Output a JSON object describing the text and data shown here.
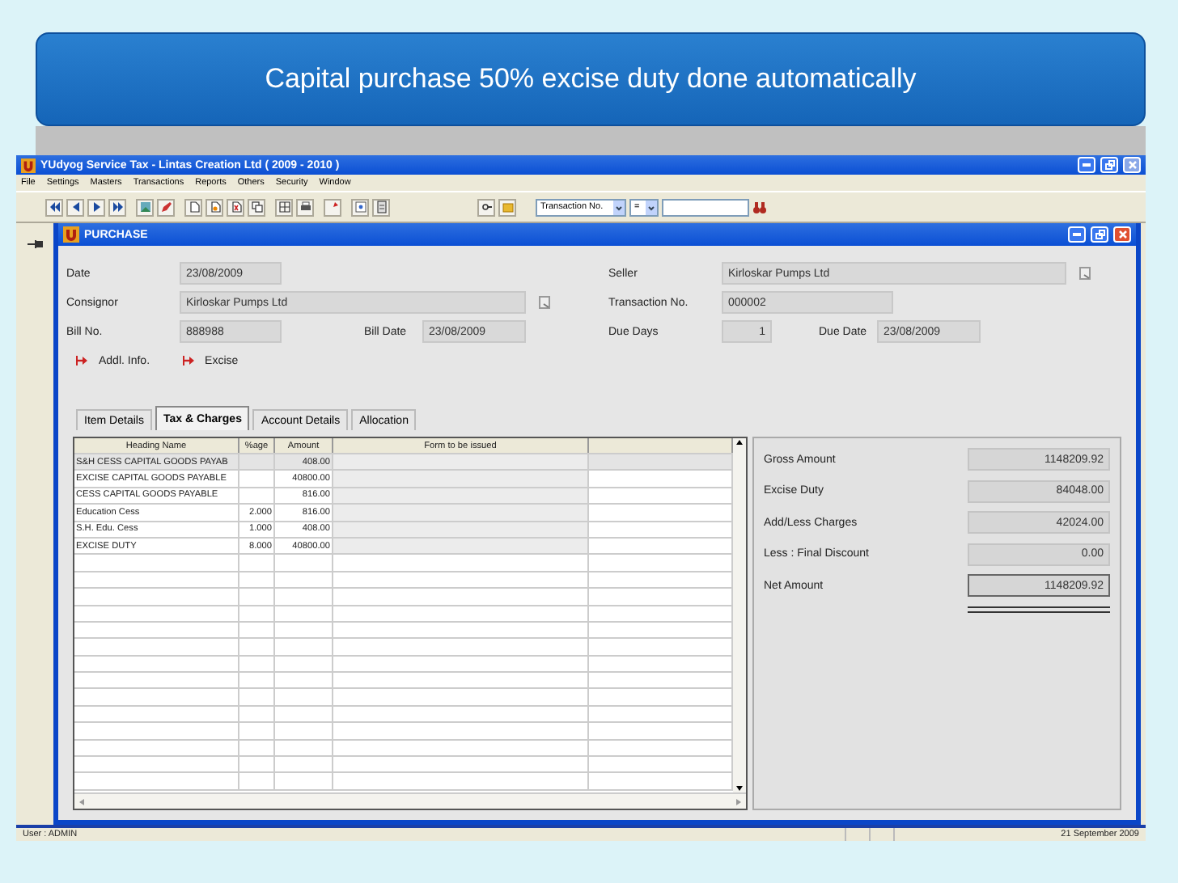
{
  "slide_title": "Capital purchase 50% excise duty done automatically",
  "app_window": {
    "title": "YUdyog Service Tax  -  Lintas Creation Ltd ( 2009 - 2010 )"
  },
  "menu": [
    "File",
    "Settings",
    "Masters",
    "Transactions",
    "Reports",
    "Others",
    "Security",
    "Window"
  ],
  "toolbar": {
    "search_by": "Transaction No.",
    "operator": "="
  },
  "purchase_window": {
    "title": "PURCHASE",
    "date": {
      "label": "Date",
      "value": "23/08/2009"
    },
    "consignor": {
      "label": "Consignor",
      "value": "Kirloskar Pumps Ltd"
    },
    "bill_no": {
      "label": "Bill No.",
      "value": "888988"
    },
    "bill_date": {
      "label": "Bill Date",
      "value": "23/08/2009"
    },
    "seller": {
      "label": "Seller",
      "value": "Kirloskar Pumps Ltd"
    },
    "transaction_no": {
      "label": "Transaction No.",
      "value": "000002"
    },
    "due_days": {
      "label": "Due Days",
      "value": "1"
    },
    "due_date": {
      "label": "Due Date",
      "value": "23/08/2009"
    },
    "links": [
      "Addl. Info.",
      "Excise"
    ],
    "tabs": [
      {
        "label": "Item Details",
        "selected": false
      },
      {
        "label": "Tax & Charges",
        "selected": true
      },
      {
        "label": "Account Details",
        "selected": false
      },
      {
        "label": "Allocation",
        "selected": false
      }
    ],
    "table": {
      "columns": [
        "Heading Name",
        "%age",
        "Amount",
        "Form to be issued"
      ],
      "rows": [
        {
          "heading": "S&H CESS CAPITAL GOODS PAYAB",
          "amount": "408.00",
          "selected": true
        },
        {
          "heading": "EXCISE CAPITAL GOODS PAYABLE",
          "amount": "40800.00",
          "selected": false
        },
        {
          "heading": "CESS CAPITAL GOODS PAYABLE",
          "amount": "816.00",
          "selected": false
        },
        {
          "heading": "Education Cess",
          "pct": "2.000",
          "amount": "816.00",
          "selected": false
        },
        {
          "heading": "S.H. Edu. Cess",
          "pct": "1.000",
          "amount": "408.00",
          "selected": false
        },
        {
          "heading": "EXCISE DUTY",
          "pct": "8.000",
          "amount": "40800.00",
          "selected": false
        }
      ]
    },
    "totals": [
      {
        "label": "Gross Amount",
        "value": "1148209.92"
      },
      {
        "label": "Excise Duty",
        "value": "84048.00"
      },
      {
        "label": "Add/Less Charges",
        "value": "42024.00"
      },
      {
        "label": "Less : Final Discount",
        "value": "0.00"
      },
      {
        "label": "Net Amount",
        "value": "1148209.92",
        "kind": "net"
      }
    ]
  },
  "status_bar": {
    "user": "User : ADMIN",
    "date": "21 September 2009"
  }
}
